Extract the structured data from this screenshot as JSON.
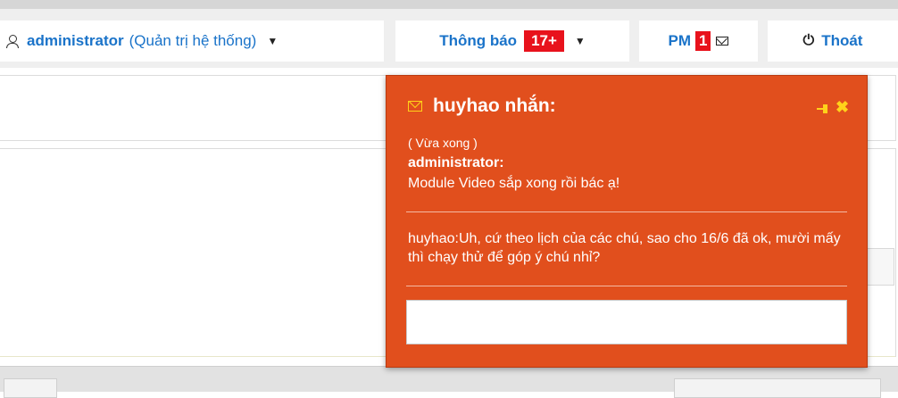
{
  "topbar": {
    "user_name": "administrator",
    "user_role": "(Quản trị hệ thống)",
    "notify_label": "Thông báo",
    "notify_count": "17+",
    "pm_label": "PM",
    "pm_count": "1",
    "logout_label": "Thoát"
  },
  "chat": {
    "title": "huyhao nhắn:",
    "time": "( Vừa xong )",
    "sender": "administrator:",
    "message": "Module Video sắp xong rồi bác ạ!",
    "reply": "huyhao:Uh, cứ theo lịch của các chú, sao cho 16/6 đã ok, mười mấy thì chạy thử để góp ý chú nhỉ?",
    "input_value": ""
  },
  "colors": {
    "accent_link": "#1a73c9",
    "badge_red": "#e8121c",
    "chat_bg": "#e14f1d",
    "chat_icon": "#ffd21a"
  },
  "icons": [
    "user-icon",
    "caret-down-icon",
    "envelope-icon",
    "power-icon",
    "mail-icon",
    "pin-icon",
    "close-icon"
  ]
}
